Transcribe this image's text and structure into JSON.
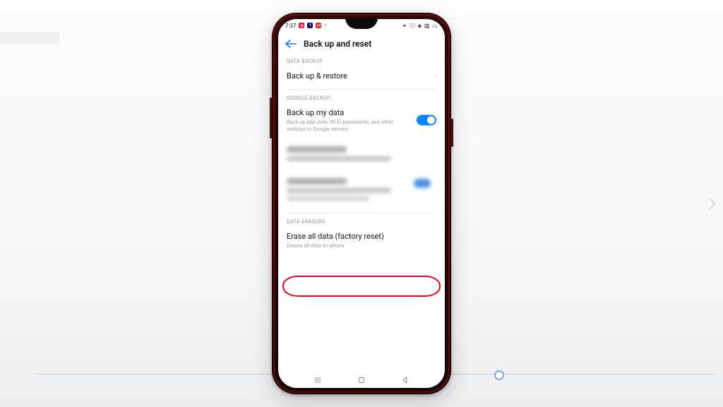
{
  "status": {
    "time": "7:37",
    "left_icons": [
      "app1",
      "fb",
      "m"
    ],
    "right_glyphs": "✱ ⓘ ⊕ ▦ ⌂"
  },
  "header": {
    "title": "Back up and reset"
  },
  "sectionDataBackup": {
    "label": "DATA BACKUP",
    "item": "Back up & restore"
  },
  "sectionGoogle": {
    "label": "GOOGLE BACKUP",
    "item_title": "Back up my data",
    "item_sub": "Back up app data, Wi-Fi passwords, and other settings to Google servers",
    "toggle_on": true
  },
  "sectionErasure": {
    "label": "DATA ERASURE",
    "item_title": "Erase all data (factory reset)",
    "item_sub": "Erases all data on phone"
  }
}
